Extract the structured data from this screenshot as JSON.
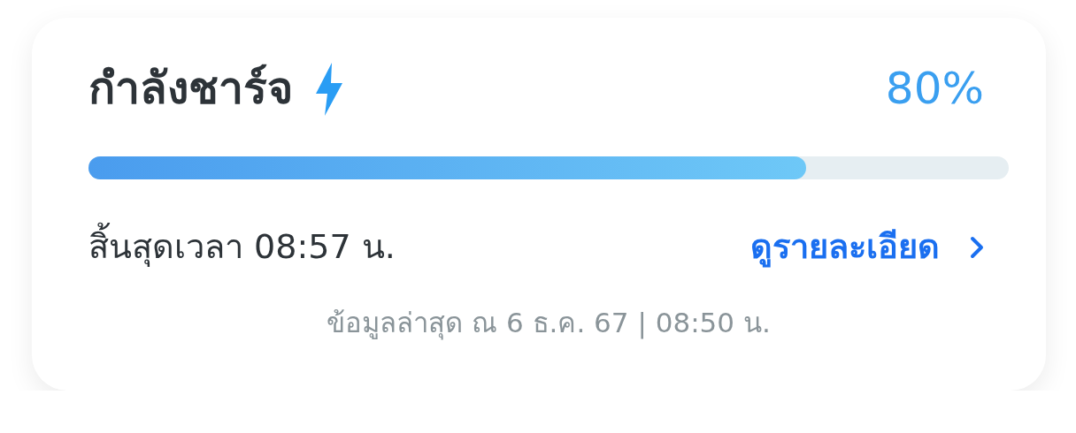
{
  "status": {
    "title": "กำลังชาร์จ",
    "percent": "80%",
    "charging": true
  },
  "progress": {
    "level": 0.78
  },
  "end_time": "สิ้นสุดเวลา 08:57 น.",
  "details_link": "ดูรายละเอียด",
  "updated": "ข้อมูลล่าสุด ณ 6 ธ.ค. 67 | 08:50 น."
}
